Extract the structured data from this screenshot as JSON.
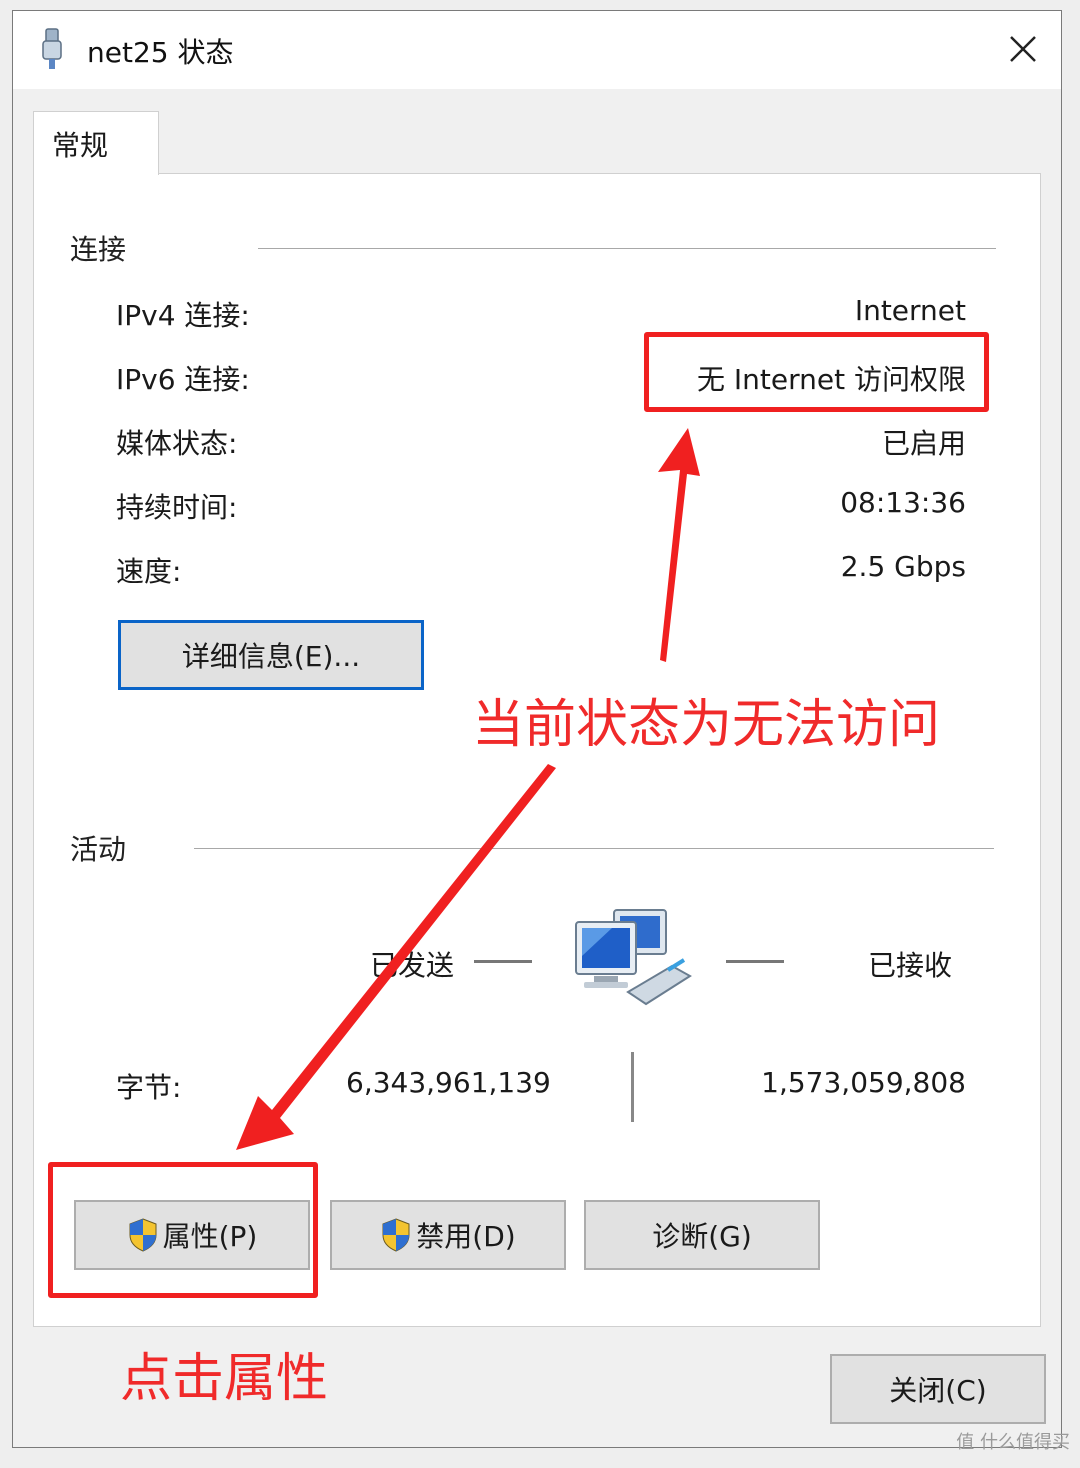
{
  "window": {
    "title": "net25 状态",
    "close_icon": "close-icon"
  },
  "tabs": [
    {
      "label": "常规"
    }
  ],
  "connection": {
    "section_title": "连接",
    "rows": [
      {
        "label": "IPv4 连接:",
        "value": "Internet"
      },
      {
        "label": "IPv6 连接:",
        "value": "无 Internet 访问权限"
      },
      {
        "label": "媒体状态:",
        "value": "已启用"
      },
      {
        "label": "持续时间:",
        "value": "08:13:36"
      },
      {
        "label": "速度:",
        "value": "2.5 Gbps"
      }
    ],
    "details_button": "详细信息(E)..."
  },
  "activity": {
    "section_title": "活动",
    "sent_label": "已发送",
    "received_label": "已接收",
    "bytes_label": "字节:",
    "bytes_sent": "6,343,961,139",
    "bytes_received": "1,573,059,808"
  },
  "buttons": {
    "properties": "属性(P)",
    "disable": "禁用(D)",
    "diagnose": "诊断(G)",
    "close": "关闭(C)"
  },
  "annotations": {
    "status_note": "当前状态为无法访问",
    "click_note": "点击属性",
    "color": "#f02020"
  },
  "watermark": "值 什么值得买"
}
